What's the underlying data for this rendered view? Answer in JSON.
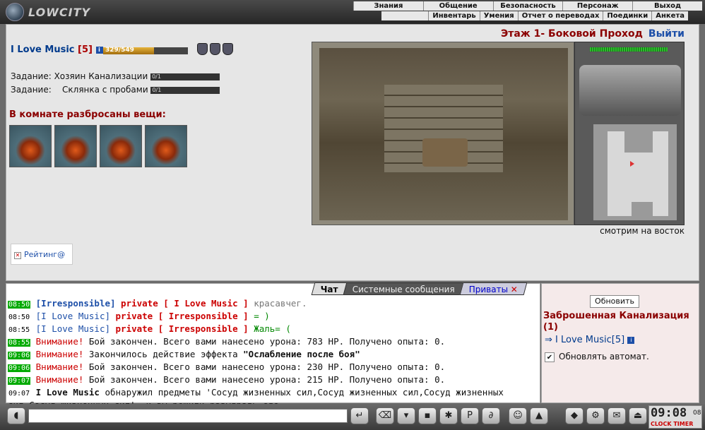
{
  "app": {
    "logo": "LOWCITY"
  },
  "nav": {
    "top": [
      "Знания",
      "Общение",
      "Безопасность",
      "Персонаж",
      "Выход"
    ],
    "sub": [
      "Инвентарь",
      "Умения",
      "Отчет о переводах",
      "Поединки",
      "Анкета"
    ]
  },
  "player": {
    "name": "I Love Music",
    "level": "[5]",
    "hp": "329/549",
    "hp_fraction": 0.6
  },
  "tasks": [
    {
      "label": "Задание: Хозяин Канализации",
      "progress": "0/1"
    },
    {
      "label": "Задание:    Склянка с пробами",
      "progress": "0/1"
    }
  ],
  "items_header": "В комнате разбросаны вещи:",
  "location": {
    "floor": "Этаж 1- Боковой Проход",
    "exit": "Выйти",
    "looking": "смотрим на восток"
  },
  "rating": "Рейтинг@",
  "chat": {
    "tabs": [
      "Чат",
      "Системные сообщения",
      "Приваты"
    ],
    "lines": [
      {
        "time": "08:50",
        "parts": [
          [
            "[Irresponsible]",
            "blue bold"
          ],
          [
            " private [ I Love Music ]",
            "red bold"
          ],
          [
            " красавчег.",
            "grey"
          ]
        ]
      },
      {
        "time": "08:50",
        "w": true,
        "parts": [
          [
            "[I Love Music]",
            "blue"
          ],
          [
            " private [ Irresponsible ]",
            "red bold"
          ],
          [
            " = )",
            "green"
          ]
        ]
      },
      {
        "time": "08:55",
        "w": true,
        "parts": [
          [
            "[I Love Music]",
            "blue"
          ],
          [
            " private [ Irresponsible ]",
            "red bold"
          ],
          [
            " Жаль= (",
            "green"
          ]
        ]
      },
      {
        "time": "08:55",
        "parts": [
          [
            "Внимание!",
            "red"
          ],
          [
            " Бой закончен. Всего вами нанесено урона: ",
            ""
          ],
          [
            "783 HP",
            ""
          ],
          [
            ". Получено опыта: ",
            ""
          ],
          [
            "0",
            ""
          ],
          [
            ".",
            ""
          ]
        ]
      },
      {
        "time": "09:06",
        "parts": [
          [
            "Внимание!",
            "red"
          ],
          [
            " Закончилось действие эффекта ",
            ""
          ],
          [
            "\"Ослабление после боя\"",
            "bold"
          ]
        ]
      },
      {
        "time": "09:06",
        "parts": [
          [
            "Внимание!",
            "red"
          ],
          [
            " Бой закончен. Всего вами нанесено урона: ",
            ""
          ],
          [
            "230 HP",
            ""
          ],
          [
            ". Получено опыта: ",
            ""
          ],
          [
            "0",
            ""
          ],
          [
            ".",
            ""
          ]
        ]
      },
      {
        "time": "09:07",
        "parts": [
          [
            "Внимание!",
            "red"
          ],
          [
            " Бой закончен. Всего вами нанесено урона: ",
            ""
          ],
          [
            "215 HP",
            ""
          ],
          [
            ". Получено опыта: ",
            ""
          ],
          [
            "0",
            ""
          ],
          [
            ".",
            ""
          ]
        ]
      },
      {
        "time": "09:07",
        "w": true,
        "parts": [
          [
            "I Love Music",
            "bold"
          ],
          [
            " обнаружил предметы 'Сосуд жизненных сил,Сосуд жизненных сил,Сосуд жизненных сил,Сосуд жизненных сил', и вы решили разыграть его",
            ""
          ]
        ]
      }
    ]
  },
  "side": {
    "refresh": "Обновить",
    "location": "Заброшенная Канализация (1)",
    "occupant": "I Love Music[5]",
    "auto": "Обновлять автомат."
  },
  "clock": {
    "time": "09:08",
    "sec": "08",
    "labels": "CLOCK TIMER"
  }
}
